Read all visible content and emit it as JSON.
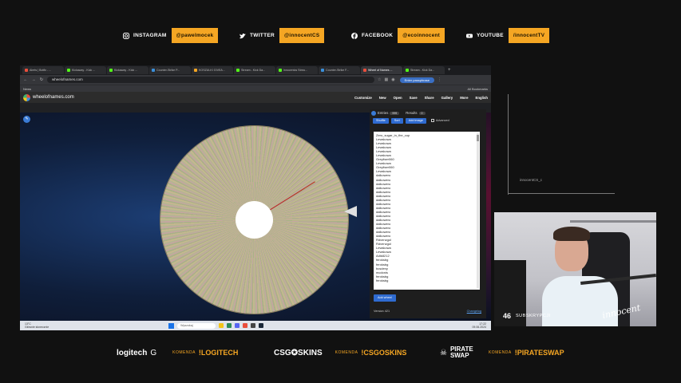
{
  "socials": [
    {
      "icon": "instagram-icon",
      "label": "INSTAGRAM",
      "handle": "@pawelmocek"
    },
    {
      "icon": "twitter-icon",
      "label": "TWITTER",
      "handle": "@innocentCS"
    },
    {
      "icon": "facebook-icon",
      "label": "FACEBOOK",
      "handle": "@ecoinnocent"
    },
    {
      "icon": "youtube-icon",
      "label": "YOUTUBE",
      "handle": "/innocentTV"
    }
  ],
  "browser": {
    "tabs": [
      {
        "label": "Alerts | Botfix - ...",
        "color": "#e94e3c"
      },
      {
        "label": "Kickaway - Kick ...",
        "color": "#53fc18"
      },
      {
        "label": "Kickaway - Kick ...",
        "color": "#53fc18"
      },
      {
        "label": "Counter-Strike P...",
        "color": "#3b8fd9"
      },
      {
        "label": "KOSZULKI GIVEA...",
        "color": "#f5a623"
      },
      {
        "label": "Stream - Kick Da...",
        "color": "#53fc18"
      },
      {
        "label": "innocentcs Strea...",
        "color": "#53fc18"
      },
      {
        "label": "Counter-Strike F...",
        "color": "#3b8fd9"
      },
      {
        "label": "Wheel of Names ...",
        "color": "#e94e3c",
        "active": true
      },
      {
        "label": "Stream - Kick Da...",
        "color": "#53fc18"
      }
    ],
    "new_tab": "+",
    "url": "wheelofnames.com",
    "ext_button": "Enter passphrase",
    "bookmark_left": "News",
    "bookmark_right": "All Bookmarks"
  },
  "site": {
    "title": "wheelofnames.com",
    "menu": [
      "Customize",
      "New",
      "Open",
      "Save",
      "Share",
      "Gallery",
      "More",
      "English"
    ]
  },
  "panel": {
    "tab_entries": "Entries",
    "entries_count": "999",
    "tab_results": "Results",
    "results_count": "0",
    "btn_shuffle": "Shuffle",
    "btn_sort": "Sort",
    "btn_add_image": "Add image",
    "advanced": "Advanced",
    "entries": [
      "Zero_sugar_in_the_cup",
      "Lewskowa",
      "Lewskowa",
      "Lewskowa",
      "Lewskowa",
      "Lewskowa",
      "Greyliser060",
      "Lewskowa",
      "Greyliser060",
      "Lewskowa",
      "dalkowero",
      "dalkowero",
      "dalkowero",
      "dalkowero",
      "dalkowero",
      "dalkowero",
      "dalkowero",
      "dalkowero",
      "dalkowero",
      "dalkowero",
      "dalkowero",
      "dalkowero",
      "dalkowero",
      "dalkowero",
      "dalkowero",
      "dalkowero",
      "Rdvenzgol",
      "Rdvenzgol",
      "Lewskowa",
      "Lewskowa",
      "Adik8212",
      "feroksbg",
      "feroksbg",
      "bcsdeny",
      "mcdonis",
      "feroksbg",
      "feroksbg"
    ],
    "add_wheel": "Add wheel",
    "version": "Version 421",
    "changelog": "Changelog"
  },
  "taskbar": {
    "weather_temp": "13°C",
    "weather_desc": "Głównie słonecznie",
    "search": "Wyszukaj",
    "time": "17:22",
    "date": "09.06.2024",
    "lang": "POL"
  },
  "side_label": "innocentCS_c",
  "webcam": {
    "subs_count": "46",
    "subs_label": "SUBSKRYPCJI",
    "signature": "innocent"
  },
  "sponsors": [
    {
      "logo": "logitech",
      "icon": "G",
      "komenda": "KOMENDA",
      "command": "!LOGITECH"
    },
    {
      "logo": "CSG✪SKINS",
      "icon": "",
      "komenda": "KOMENDA",
      "command": "!CSGOSKINS"
    },
    {
      "logo": "PIRATE SWAP",
      "icon": "☠",
      "komenda": "KOMENDA",
      "command": "!PIRATESWAP"
    }
  ]
}
